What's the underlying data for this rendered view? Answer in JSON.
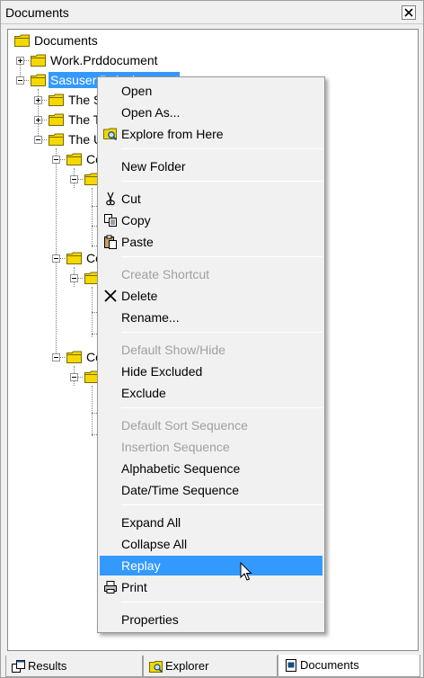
{
  "window": {
    "title": "Documents"
  },
  "tree": {
    "root": "Documents",
    "items": [
      {
        "label": "Work.Prddocument"
      },
      {
        "label": "Sasuser.Prdsale.report"
      },
      {
        "label": "The S"
      },
      {
        "label": "The T"
      },
      {
        "label": "The U"
      },
      {
        "label": "Co"
      },
      {
        "label": "Co"
      },
      {
        "label": "Co"
      }
    ]
  },
  "context_menu": {
    "items": {
      "open": "Open",
      "open_as": "Open As...",
      "explore": "Explore from Here",
      "new_folder": "New Folder",
      "cut": "Cut",
      "copy": "Copy",
      "paste": "Paste",
      "create_shortcut": "Create Shortcut",
      "delete": "Delete",
      "rename": "Rename...",
      "default_showhide": "Default Show/Hide",
      "hide_excluded": "Hide Excluded",
      "exclude": "Exclude",
      "default_sort": "Default Sort Sequence",
      "insertion_seq": "Insertion Sequence",
      "alpha_seq": "Alphabetic Sequence",
      "datetime_seq": "Date/Time Sequence",
      "expand_all": "Expand All",
      "collapse_all": "Collapse All",
      "replay": "Replay",
      "print": "Print",
      "properties": "Properties"
    }
  },
  "tabs": {
    "results": "Results",
    "explorer": "Explorer",
    "documents": "Documents"
  },
  "colors": {
    "selection": "#3399ff",
    "folder": "#f5d800"
  }
}
